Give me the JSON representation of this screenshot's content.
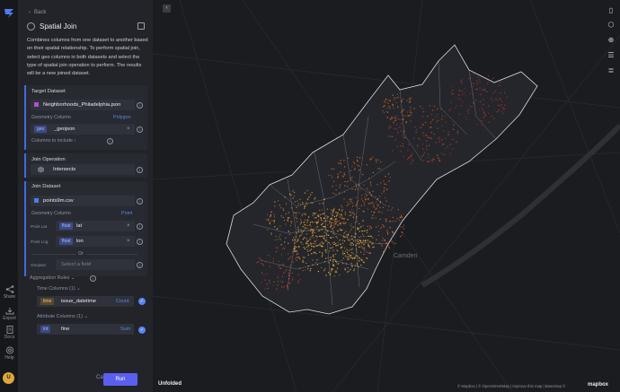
{
  "rail": {
    "share": "Share",
    "export": "Export",
    "docs": "Docs",
    "help": "Help",
    "avatar": "U"
  },
  "panel": {
    "back": "Back",
    "title": "Spatial Join",
    "description": "Combines columns from one dataset to another based on their spatial relationship. To perform spatial join, select geo columns in both datasets and select the type of spatial join operation to perform. The results will be a new joined dataset.",
    "target": {
      "header": "Target Dataset",
      "dataset": "Neighborhoods_Philadelphia.json",
      "dataset_color": "#b14fd6",
      "geometry_label": "Geometry Column",
      "geometry_type": "Polygon",
      "geo_tag": "geo",
      "geo_value": "_geojson",
      "columns_to_include": "Columns to include"
    },
    "operation": {
      "header": "Join Operation",
      "value": "Intersects"
    },
    "join": {
      "header": "Join Dataset",
      "dataset": "points9m.csv",
      "dataset_color": "#4c7df0",
      "geometry_label": "Geometry Column",
      "geometry_type": "Point",
      "lat_label": "Point Lat",
      "lat_tag": "float",
      "lat_value": "lat",
      "lng_label": "Point Lng",
      "lng_tag": "float",
      "lng_value": "lon",
      "or": "Or",
      "geojson_label": "Geojson",
      "geojson_placeholder": "Select a field"
    },
    "aggregation": {
      "header": "Aggregation Rules",
      "time_columns": "Time Columns (1)",
      "time_tag": "time",
      "time_value": "issue_datetime",
      "time_agg": "Count",
      "attr_columns": "Attribute Columns (1)",
      "attr_tag": "int",
      "attr_value": "fine",
      "attr_agg": "Sum"
    },
    "cancel": "Cancel",
    "run": "Run"
  },
  "map": {
    "city_label": "Camden",
    "brand": "Unfolded",
    "attribution": "© Mapbox | © OpenStreetMap | Improve this map | Basemap ©",
    "mapbox": "mapbox",
    "colors": {
      "hot": "#f6b73c",
      "mid": "#e2732b",
      "low": "#b8322a",
      "boundary": "#d9dce2"
    }
  }
}
